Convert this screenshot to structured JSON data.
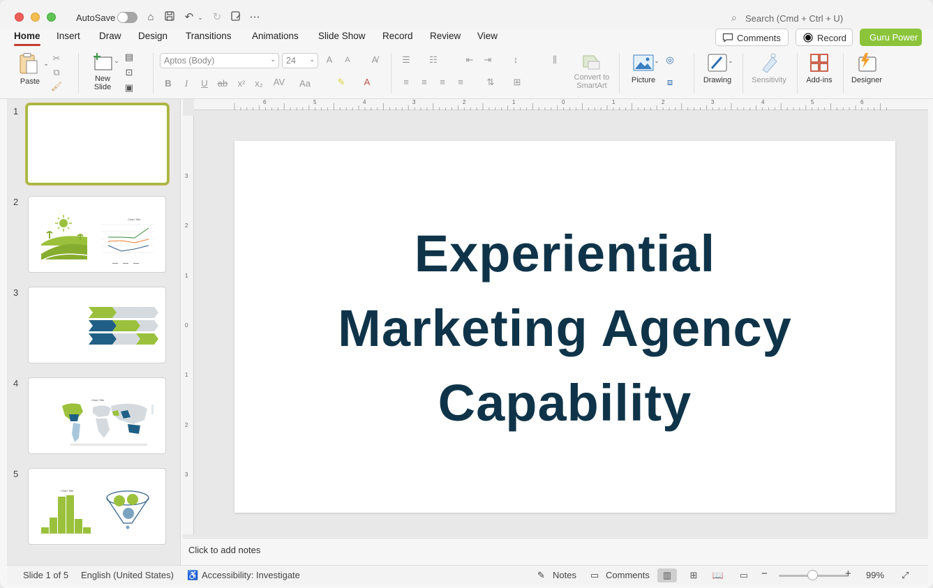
{
  "titlebar": {
    "autosave_label": "AutoSave",
    "search_placeholder": "Search (Cmd + Ctrl + U)"
  },
  "tabs": [
    {
      "label": "Home",
      "active": true
    },
    {
      "label": "Insert"
    },
    {
      "label": "Draw"
    },
    {
      "label": "Design"
    },
    {
      "label": "Transitions"
    },
    {
      "label": "Animations"
    },
    {
      "label": "Slide Show"
    },
    {
      "label": "Record"
    },
    {
      "label": "Review"
    },
    {
      "label": "View"
    }
  ],
  "header_buttons": {
    "comments": "Comments",
    "record": "Record",
    "guru": "Guru Power"
  },
  "ribbon": {
    "paste": "Paste",
    "new_slide_line1": "New",
    "new_slide_line2": "Slide",
    "font_name": "Aptos (Body)",
    "font_size": "24",
    "convert_line1": "Convert to",
    "convert_line2": "SmartArt",
    "picture": "Picture",
    "drawing": "Drawing",
    "sensitivity": "Sensitivity",
    "addins": "Add-ins",
    "designer": "Designer"
  },
  "ruler": {
    "h_ticks": [
      "6",
      "5",
      "4",
      "3",
      "2",
      "1",
      "0",
      "1",
      "2",
      "3",
      "4",
      "5",
      "6"
    ],
    "v_ticks": [
      "3",
      "2",
      "1",
      "0",
      "1",
      "2",
      "3"
    ]
  },
  "thumbnails": [
    {
      "number": "1"
    },
    {
      "number": "2",
      "chart_title": "Chart Title"
    },
    {
      "number": "3"
    },
    {
      "number": "4",
      "chart_title": "Chart Title"
    },
    {
      "number": "5",
      "chart_title": "Chart Title"
    }
  ],
  "slide": {
    "title_line1": "Experiential",
    "title_line2": "Marketing Agency",
    "title_line3": "Capability"
  },
  "notes": {
    "placeholder": "Click to add notes"
  },
  "status": {
    "slide_indicator": "Slide 1 of 5",
    "language": "English (United States)",
    "accessibility": "Accessibility: Investigate",
    "notes": "Notes",
    "comments": "Comments",
    "zoom": "99%"
  },
  "colors": {
    "title_text": "#0f3449",
    "accent_red": "#c33c2b",
    "guru_green": "#8bc43a",
    "thumb_green": "#9bc13c",
    "thumb_blue": "#1f5f85"
  }
}
